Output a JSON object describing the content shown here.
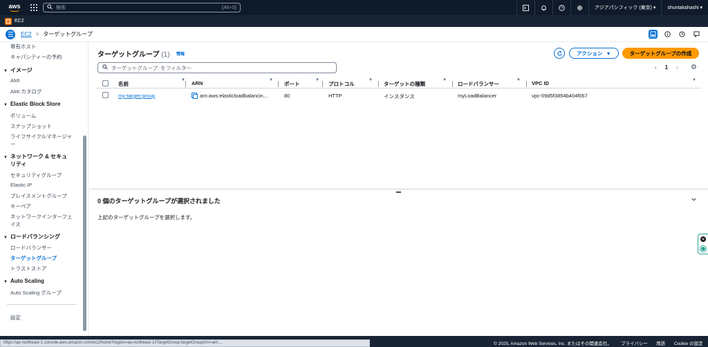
{
  "topnav": {
    "logo_text": "aws",
    "search_placeholder": "検索",
    "search_shortcut": "[Alt+S]",
    "region": "アジアパシフィック (東京) ▾",
    "user": "shuntakahashi ▾"
  },
  "service": {
    "name": "EC2"
  },
  "breadcrumb": {
    "parent": "EC2",
    "separator": ">",
    "current": "ターゲットグループ"
  },
  "sidebar": {
    "items_top": [
      "専有ホスト",
      "キャパシティーの予約"
    ],
    "sections": [
      {
        "title": "イメージ",
        "items": [
          "AMI",
          "AMI カタログ"
        ]
      },
      {
        "title": "Elastic Block Store",
        "items": [
          "ボリューム",
          "スナップショット",
          "ライフサイクルマネージャ",
          "ー"
        ]
      },
      {
        "title_line1": "ネットワーク & セキュ",
        "title_line2": "リティ",
        "items": [
          "セキュリティグループ",
          "Elastic IP",
          "プレイスメントグループ",
          "キーペア",
          "ネットワークインターフェ",
          "イス"
        ]
      },
      {
        "title": "ロードバランシング",
        "items": [
          "ロードバランサー",
          "ターゲットグループ",
          "トラストストア"
        ]
      },
      {
        "title": "Auto Scaling",
        "items": [
          "Auto Scaling グループ"
        ]
      }
    ],
    "settings": "設定"
  },
  "panel": {
    "title": "ターゲットグループ",
    "count": "(1)",
    "info": "情報",
    "refresh_icon": "refresh-icon",
    "action_label": "アクション",
    "create_label": "ターゲットグループの作成",
    "filter_placeholder": "ターゲットグループ: をフィルター",
    "page": "1"
  },
  "table": {
    "columns": [
      "名前",
      "ARN",
      "ポート",
      "プロトコル",
      "ターゲットの種類",
      "ロードバランサー",
      "VPC ID"
    ],
    "rows": [
      {
        "name": "my-target-group",
        "arn": "arn:aws:elasticloadbalancin...",
        "port": "80",
        "protocol": "HTTP",
        "target_type": "インスタンス",
        "load_balancer": "myLoadBalancer",
        "vpc_id": "vpc-09d5f3854b404f067"
      }
    ]
  },
  "selection": {
    "title": "0 個のターゲットグループが選択されました",
    "desc": "上記のターゲットグループを選択します。"
  },
  "footer": {
    "copyright": "© 2025, Amazon Web Services, Inc. またはその関連会社。",
    "privacy": "プライバシー",
    "terms": "用語",
    "cookie": "Cookie の設定"
  },
  "status_url": "https://ap-northeast-1.console.aws.amazon.com/ec2/home?region=ap-northeast-1#TargetGroup:targetGroupArn=arn:..."
}
